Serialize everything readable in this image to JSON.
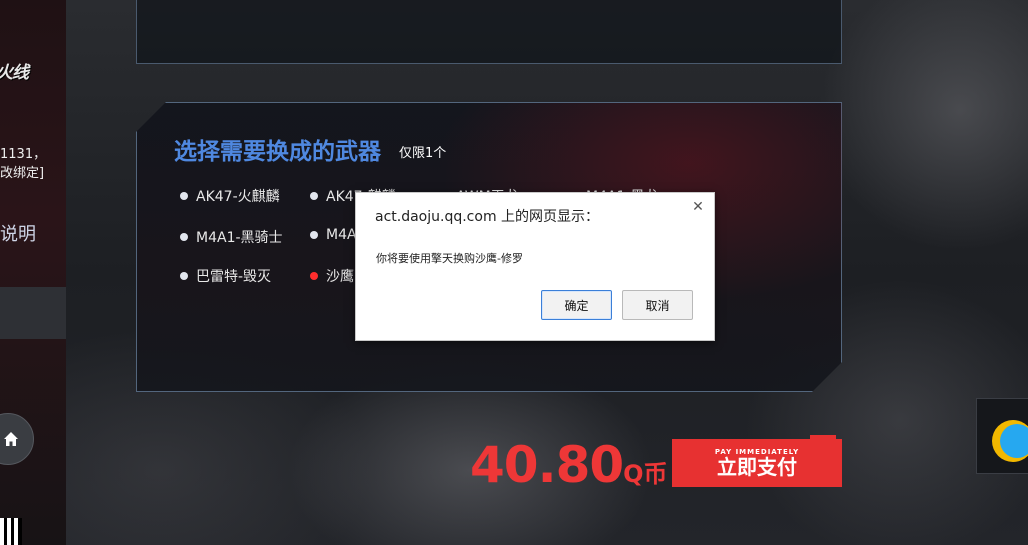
{
  "sidebar": {
    "logo_text": "火线",
    "account_line1": "1131，",
    "account_line2": "改绑定]",
    "section_label": "说明",
    "home_icon": "home-icon"
  },
  "panel": {
    "title": "选择需要换成的武器",
    "limit_note": "仅限1个",
    "weapons": [
      {
        "label": "AK47-火麒麟",
        "selected": false
      },
      {
        "label": "AK47-麒麟",
        "selected": false
      },
      {
        "label": "AWM天龙",
        "selected": false
      },
      {
        "label": "M4A1-黑龙",
        "selected": false
      },
      {
        "label": "M4A1-黑骑士",
        "selected": false
      },
      {
        "label": "M4A",
        "selected": false
      },
      {
        "label": "巴雷特-毁灭",
        "selected": false
      },
      {
        "label": "沙鹰",
        "selected": true
      }
    ]
  },
  "purchase": {
    "price": "40.80",
    "currency": "Q币",
    "pay_label_en": "PAY IMMEDIATELY",
    "pay_label": "立即支付"
  },
  "dialog": {
    "origin": "act.daoju.qq.com 上的网页显示：",
    "message": "你将要使用擎天换购沙鹰-修罗",
    "ok_label": "确定",
    "cancel_label": "取消",
    "close_icon": "close-icon"
  },
  "colors": {
    "accent_red": "#e73131",
    "title_blue": "#4f88e0",
    "selected_dot": "#ff2d2d"
  }
}
